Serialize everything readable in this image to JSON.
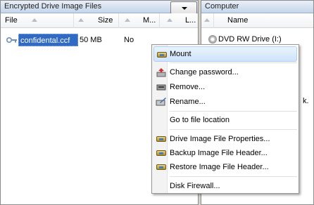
{
  "left_pane": {
    "title": "Encrypted Drive Image Files",
    "columns": [
      "File",
      "Size",
      "M...",
      "L..."
    ],
    "row": {
      "file": "confidental.ccf",
      "size": "50 MB",
      "mounted": "No"
    }
  },
  "right_pane": {
    "title": "Computer",
    "columns": [
      "Name"
    ],
    "drive": "DVD RW Drive (I:)",
    "partial_text": "k."
  },
  "context_menu": {
    "mount": "Mount",
    "change_password": "Change password...",
    "remove": "Remove...",
    "rename": "Rename...",
    "go_to_location": "Go to file location",
    "properties": "Drive Image File Properties...",
    "backup_header": "Backup Image File Header...",
    "restore_header": "Restore Image File Header...",
    "disk_firewall": "Disk Firewall..."
  }
}
